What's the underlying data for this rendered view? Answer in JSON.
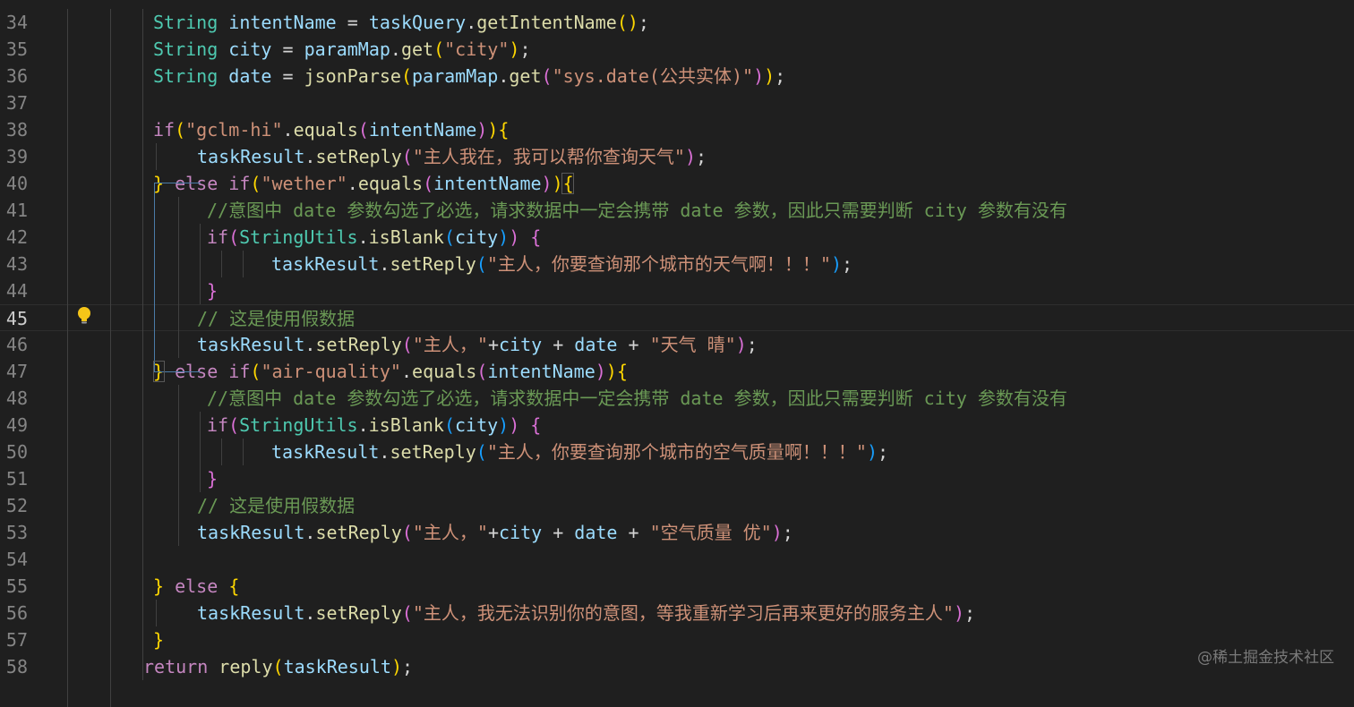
{
  "theme": {
    "background": "#1f1f1f",
    "keyword": "#c586c0",
    "type": "#4ec9b0",
    "variable": "#9cdcfe",
    "function": "#dcdcaa",
    "string": "#ce9178",
    "comment": "#6a9955",
    "bracket_1": "#ffd700",
    "bracket_2": "#da70d6",
    "bracket_3": "#179fff",
    "punctuation": "#d4d4d4",
    "line_number": "#858585",
    "lightbulb": "#f5c518"
  },
  "editor": {
    "current_line": 45,
    "lightbulb_icon": "lightbulb-icon",
    "lines": [
      {
        "n": "34",
        "tokens": [
          [
            "type",
            "String"
          ],
          [
            "p",
            " "
          ],
          [
            "var",
            "intentName"
          ],
          [
            "p",
            " = "
          ],
          [
            "var",
            "taskQuery"
          ],
          [
            "p",
            "."
          ],
          [
            "fn",
            "getIntentName"
          ],
          [
            "b1",
            "()"
          ],
          [
            "p",
            ";"
          ]
        ]
      },
      {
        "n": "35",
        "tokens": [
          [
            "type",
            "String"
          ],
          [
            "p",
            " "
          ],
          [
            "var",
            "city"
          ],
          [
            "p",
            " = "
          ],
          [
            "var",
            "paramMap"
          ],
          [
            "p",
            "."
          ],
          [
            "fn",
            "get"
          ],
          [
            "b1",
            "("
          ],
          [
            "str",
            "\"city\""
          ],
          [
            "b1",
            ")"
          ],
          [
            "p",
            ";"
          ]
        ]
      },
      {
        "n": "36",
        "tokens": [
          [
            "type",
            "String"
          ],
          [
            "p",
            " "
          ],
          [
            "var",
            "date"
          ],
          [
            "p",
            " = "
          ],
          [
            "fn",
            "jsonParse"
          ],
          [
            "b1",
            "("
          ],
          [
            "var",
            "paramMap"
          ],
          [
            "p",
            "."
          ],
          [
            "fn",
            "get"
          ],
          [
            "b2",
            "("
          ],
          [
            "str",
            "\"sys.date(公共实体)\""
          ],
          [
            "b2",
            ")"
          ],
          [
            "b1",
            ")"
          ],
          [
            "p",
            ";"
          ]
        ]
      },
      {
        "n": "37",
        "tokens": []
      },
      {
        "n": "38",
        "tokens": [
          [
            "kw",
            "if"
          ],
          [
            "b1",
            "("
          ],
          [
            "str",
            "\"gclm-hi\""
          ],
          [
            "p",
            "."
          ],
          [
            "fn",
            "equals"
          ],
          [
            "b2",
            "("
          ],
          [
            "var",
            "intentName"
          ],
          [
            "b2",
            ")"
          ],
          [
            "b1",
            ")"
          ],
          [
            "b1",
            "{"
          ]
        ]
      },
      {
        "n": "39",
        "tokens": [
          [
            "var",
            "taskResult"
          ],
          [
            "p",
            "."
          ],
          [
            "fn",
            "setReply"
          ],
          [
            "b2",
            "("
          ],
          [
            "str",
            "\"主人我在，我可以帮你查询天气\""
          ],
          [
            "b2",
            ")"
          ],
          [
            "p",
            ";"
          ]
        ]
      },
      {
        "n": "40",
        "tokens": [
          [
            "b1",
            "}"
          ],
          [
            "p",
            " "
          ],
          [
            "kw",
            "else if"
          ],
          [
            "b1",
            "("
          ],
          [
            "str",
            "\"wether\""
          ],
          [
            "p",
            "."
          ],
          [
            "fn",
            "equals"
          ],
          [
            "b2",
            "("
          ],
          [
            "var",
            "intentName"
          ],
          [
            "b2",
            ")"
          ],
          [
            "b1",
            ")"
          ],
          [
            "b1",
            "{"
          ]
        ]
      },
      {
        "n": "41",
        "tokens": [
          [
            "cm",
            "//意图中 date 参数勾选了必选，请求数据中一定会携带 date 参数，因此只需要判断 city 参数有没有"
          ]
        ]
      },
      {
        "n": "42",
        "tokens": [
          [
            "kw",
            "if"
          ],
          [
            "b2",
            "("
          ],
          [
            "type",
            "StringUtils"
          ],
          [
            "p",
            "."
          ],
          [
            "fn",
            "isBlank"
          ],
          [
            "b3",
            "("
          ],
          [
            "var",
            "city"
          ],
          [
            "b3",
            ")"
          ],
          [
            "b2",
            ")"
          ],
          [
            "p",
            " "
          ],
          [
            "b2",
            "{"
          ]
        ]
      },
      {
        "n": "43",
        "tokens": [
          [
            "var",
            "taskResult"
          ],
          [
            "p",
            "."
          ],
          [
            "fn",
            "setReply"
          ],
          [
            "b3",
            "("
          ],
          [
            "str",
            "\"主人，你要查询那个城市的天气啊！！！\""
          ],
          [
            "b3",
            ")"
          ],
          [
            "p",
            ";"
          ]
        ]
      },
      {
        "n": "44",
        "tokens": [
          [
            "b2",
            "}"
          ]
        ]
      },
      {
        "n": "45",
        "tokens": [
          [
            "cm",
            "// 这是使用假数据"
          ]
        ]
      },
      {
        "n": "46",
        "tokens": [
          [
            "var",
            "taskResult"
          ],
          [
            "p",
            "."
          ],
          [
            "fn",
            "setReply"
          ],
          [
            "b2",
            "("
          ],
          [
            "str",
            "\"主人，\""
          ],
          [
            "p",
            "+"
          ],
          [
            "var",
            "city"
          ],
          [
            "p",
            " + "
          ],
          [
            "var",
            "date"
          ],
          [
            "p",
            " + "
          ],
          [
            "str",
            "\"天气 晴\""
          ],
          [
            "b2",
            ")"
          ],
          [
            "p",
            ";"
          ]
        ]
      },
      {
        "n": "47",
        "tokens": [
          [
            "b1",
            "}"
          ],
          [
            "p",
            " "
          ],
          [
            "kw",
            "else if"
          ],
          [
            "b1",
            "("
          ],
          [
            "str",
            "\"air-quality\""
          ],
          [
            "p",
            "."
          ],
          [
            "fn",
            "equals"
          ],
          [
            "b2",
            "("
          ],
          [
            "var",
            "intentName"
          ],
          [
            "b2",
            ")"
          ],
          [
            "b1",
            ")"
          ],
          [
            "b1",
            "{"
          ]
        ]
      },
      {
        "n": "48",
        "tokens": [
          [
            "cm",
            "//意图中 date 参数勾选了必选，请求数据中一定会携带 date 参数，因此只需要判断 city 参数有没有"
          ]
        ]
      },
      {
        "n": "49",
        "tokens": [
          [
            "kw",
            "if"
          ],
          [
            "b2",
            "("
          ],
          [
            "type",
            "StringUtils"
          ],
          [
            "p",
            "."
          ],
          [
            "fn",
            "isBlank"
          ],
          [
            "b3",
            "("
          ],
          [
            "var",
            "city"
          ],
          [
            "b3",
            ")"
          ],
          [
            "b2",
            ")"
          ],
          [
            "p",
            " "
          ],
          [
            "b2",
            "{"
          ]
        ]
      },
      {
        "n": "50",
        "tokens": [
          [
            "var",
            "taskResult"
          ],
          [
            "p",
            "."
          ],
          [
            "fn",
            "setReply"
          ],
          [
            "b3",
            "("
          ],
          [
            "str",
            "\"主人，你要查询那个城市的空气质量啊！！！\""
          ],
          [
            "b3",
            ")"
          ],
          [
            "p",
            ";"
          ]
        ]
      },
      {
        "n": "51",
        "tokens": [
          [
            "b2",
            "}"
          ]
        ]
      },
      {
        "n": "52",
        "tokens": [
          [
            "cm",
            "// 这是使用假数据"
          ]
        ]
      },
      {
        "n": "53",
        "tokens": [
          [
            "var",
            "taskResult"
          ],
          [
            "p",
            "."
          ],
          [
            "fn",
            "setReply"
          ],
          [
            "b2",
            "("
          ],
          [
            "str",
            "\"主人，\""
          ],
          [
            "p",
            "+"
          ],
          [
            "var",
            "city"
          ],
          [
            "p",
            " + "
          ],
          [
            "var",
            "date"
          ],
          [
            "p",
            " + "
          ],
          [
            "str",
            "\"空气质量 优\""
          ],
          [
            "b2",
            ")"
          ],
          [
            "p",
            ";"
          ]
        ]
      },
      {
        "n": "54",
        "tokens": []
      },
      {
        "n": "55",
        "tokens": [
          [
            "b1",
            "}"
          ],
          [
            "p",
            " "
          ],
          [
            "kw",
            "else"
          ],
          [
            "p",
            " "
          ],
          [
            "b1",
            "{"
          ]
        ]
      },
      {
        "n": "56",
        "tokens": [
          [
            "var",
            "taskResult"
          ],
          [
            "p",
            "."
          ],
          [
            "fn",
            "setReply"
          ],
          [
            "b2",
            "("
          ],
          [
            "str",
            "\"主人，我无法识别你的意图，等我重新学习后再来更好的服务主人\""
          ],
          [
            "b2",
            ")"
          ],
          [
            "p",
            ";"
          ]
        ]
      },
      {
        "n": "57",
        "tokens": [
          [
            "b1",
            "}"
          ]
        ]
      },
      {
        "n": "58",
        "tokens": [
          [
            "kw",
            "return"
          ],
          [
            "p",
            " "
          ],
          [
            "fn",
            "reply"
          ],
          [
            "b1",
            "("
          ],
          [
            "var",
            "taskResult"
          ],
          [
            "b1",
            ")"
          ],
          [
            "p",
            ";"
          ]
        ]
      }
    ]
  },
  "watermark": {
    "text": "@稀土掘金技术社区"
  }
}
